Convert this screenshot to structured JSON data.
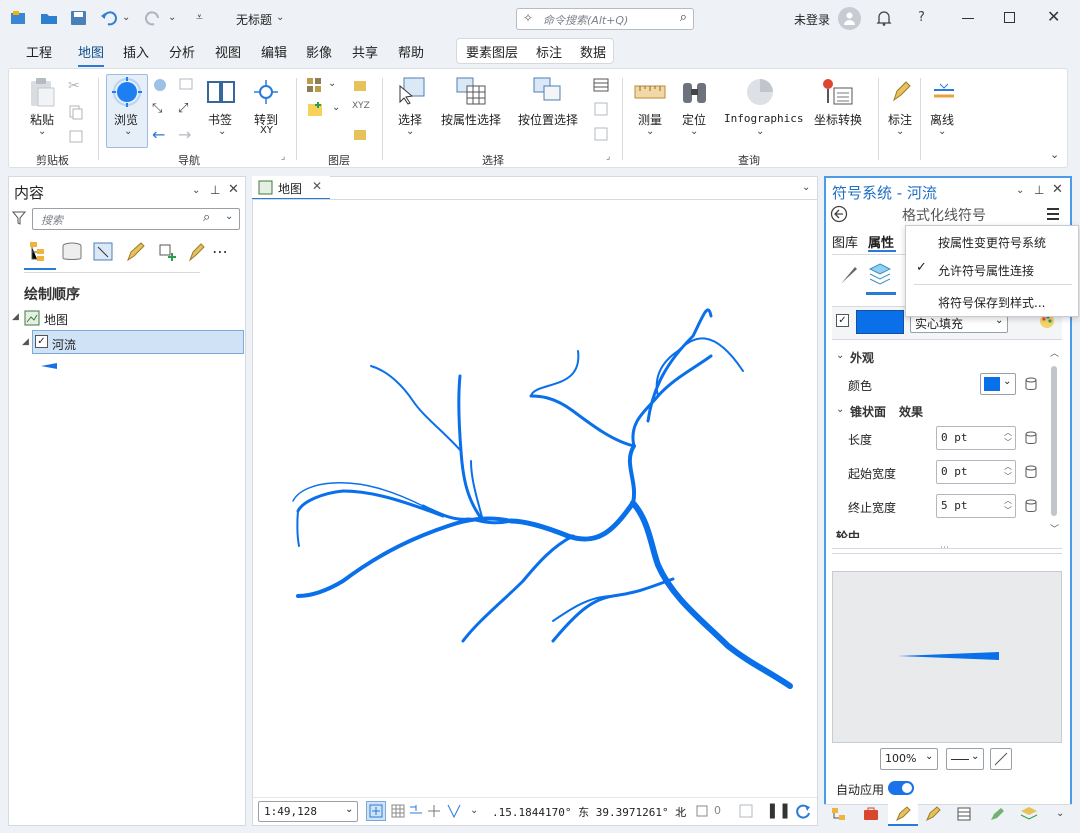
{
  "titlebar": {
    "title": "无标题",
    "search_placeholder": "命令搜索(Alt+Q)",
    "user": "未登录",
    "help": "?"
  },
  "ribbon_tabs": [
    "工程",
    "地图",
    "插入",
    "分析",
    "视图",
    "编辑",
    "影像",
    "共享",
    "帮助"
  ],
  "ribbon_ctx_tabs": [
    "要素图层",
    "标注",
    "数据"
  ],
  "ribbon": {
    "paste": "粘贴",
    "browse": "浏览",
    "bookmark": "书签",
    "goto": "转到",
    "goto_sub": "XY",
    "select": "选择",
    "select_by_attr": "按属性选择",
    "select_by_loc": "按位置选择",
    "measure": "测量",
    "locate": "定位",
    "infographics": "Infographics",
    "coord_convert": "坐标转换",
    "annotate": "标注",
    "offline": "离线",
    "groups": {
      "clipboard": "剪贴板",
      "navigate": "导航",
      "layer": "图层",
      "selection": "选择",
      "inquiry": "查询"
    }
  },
  "contents": {
    "title": "内容",
    "search_placeholder": "搜索",
    "draw_order": "绘制顺序",
    "map_item": "地图",
    "layer_item": "河流"
  },
  "map_view": {
    "tab": "地图",
    "scale": "1:49,128",
    "coords": ".15.1844170° 东  39.3971261° 北",
    "selected_count": "0"
  },
  "symbology": {
    "title": "符号系统 - 河流",
    "subtitle": "格式化线符号",
    "tabs": [
      "图库",
      "属性"
    ],
    "fill_type": "实心填充",
    "sections": {
      "appearance": "外观",
      "taper": "锥状面",
      "effects": "效果",
      "partial": "轮中"
    },
    "rows": {
      "color": "颜色",
      "length": "长度",
      "start_width": "起始宽度",
      "end_width": "终止宽度"
    },
    "values": {
      "length": "0 pt",
      "start_width": "0 pt",
      "end_width": "5 pt"
    },
    "zoom": "100%",
    "auto_apply": "自动应用"
  },
  "context_menu": {
    "item1": "按属性变更符号系统",
    "item2": "允许符号属性连接",
    "item3": "将符号保存到样式..."
  },
  "colors": {
    "accent": "#1a73e8",
    "river": "#0a70ea",
    "window_bg": "#eef1f5"
  }
}
